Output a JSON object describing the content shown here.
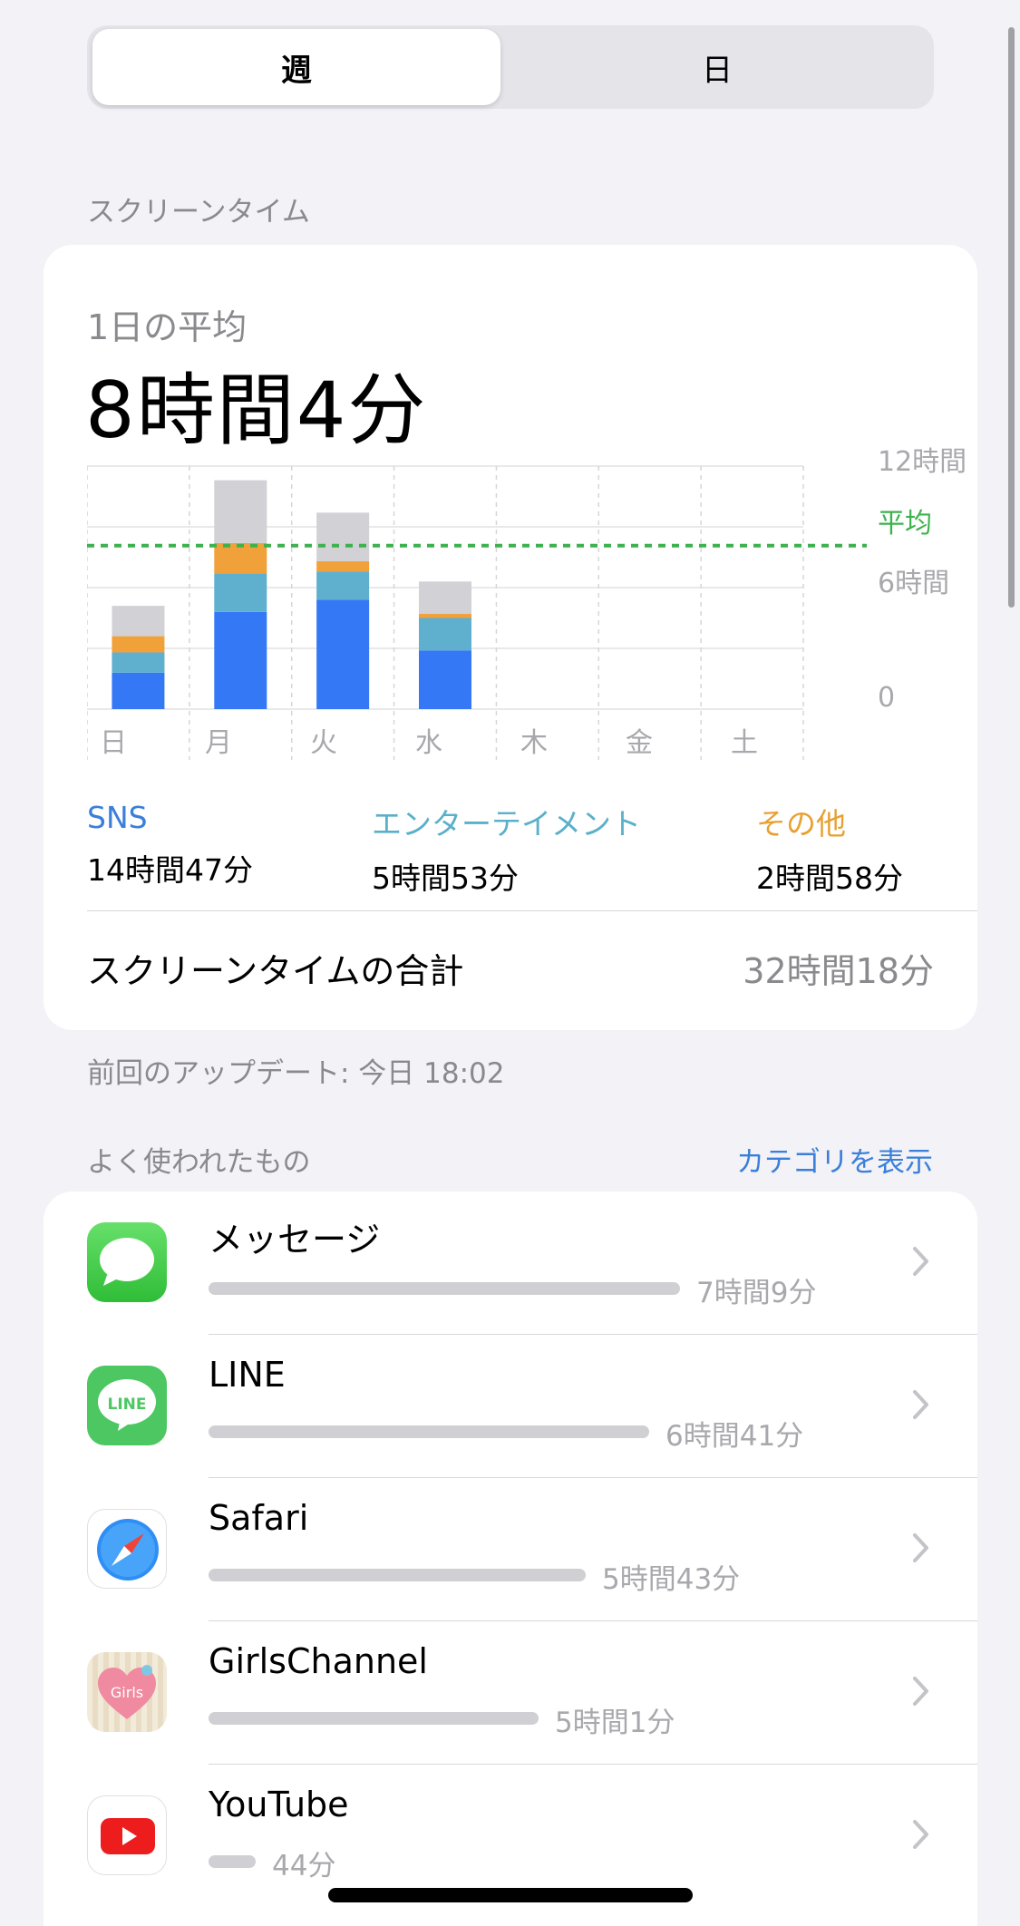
{
  "segment": {
    "week": "週",
    "day": "日"
  },
  "screen_time_header": "スクリーンタイム",
  "summary": {
    "avg_label": "1日の平均",
    "avg_value": "8時間4分",
    "total_label": "スクリーンタイムの合計",
    "total_value": "32時間18分",
    "update_text": "前回のアップデート: 今日 18:02"
  },
  "chart_data": {
    "type": "bar",
    "stacked": true,
    "categories": [
      "日",
      "月",
      "火",
      "水",
      "木",
      "金",
      "土"
    ],
    "ylim": [
      0,
      12
    ],
    "ytick_labels": [
      "12時間",
      "6時間",
      "0"
    ],
    "avg_line": {
      "value": 8.07,
      "label": "平均"
    },
    "series": [
      {
        "name": "SNS",
        "color": "#3478f6",
        "values": [
          1.8,
          4.8,
          5.4,
          2.9,
          0,
          0,
          0
        ]
      },
      {
        "name": "エンターテイメント",
        "color": "#5fb0cf",
        "values": [
          1.0,
          1.9,
          1.4,
          1.6,
          0,
          0,
          0
        ]
      },
      {
        "name": "その他",
        "color": "#f1a13a",
        "values": [
          0.8,
          1.5,
          0.5,
          0.2,
          0,
          0,
          0
        ]
      },
      {
        "color": "#d1d1d6",
        "values": [
          1.5,
          3.1,
          2.4,
          1.6,
          0,
          0,
          0
        ]
      }
    ]
  },
  "legend": [
    {
      "name": "SNS",
      "value": "14時間47分",
      "color": "#3a7fd9"
    },
    {
      "name": "エンターテイメント",
      "value": "5時間53分",
      "color": "#5ab0c9"
    },
    {
      "name": "その他",
      "value": "2時間58分",
      "color": "#e8a030"
    }
  ],
  "most_used": {
    "header": "よく使われたもの",
    "show_categories": "カテゴリを表示",
    "apps": [
      {
        "name": "メッセージ",
        "time": "7時間9分",
        "fraction": 1.0,
        "icon": "messages-icon"
      },
      {
        "name": "LINE",
        "time": "6時間41分",
        "fraction": 0.935,
        "icon": "line-icon"
      },
      {
        "name": "Safari",
        "time": "5時間43分",
        "fraction": 0.8,
        "icon": "safari-icon"
      },
      {
        "name": "GirlsChannel",
        "time": "5時間1分",
        "fraction": 0.7,
        "icon": "girlschannel-icon",
        "icon_text": "Girls"
      },
      {
        "name": "YouTube",
        "time": "44分",
        "fraction": 0.1,
        "icon": "youtube-icon"
      }
    ]
  }
}
